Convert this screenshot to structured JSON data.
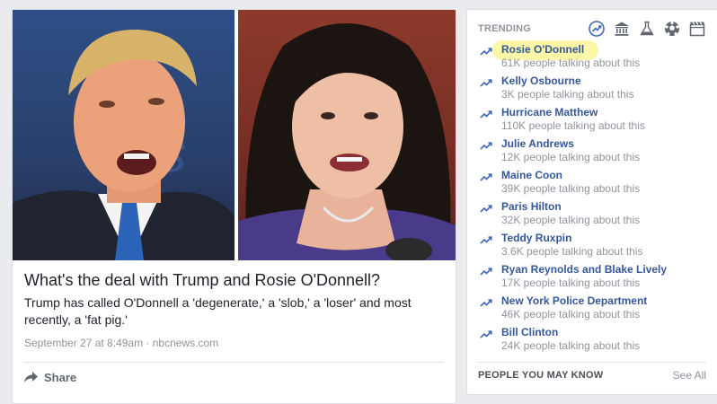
{
  "story": {
    "title": "What's the deal with Trump and Rosie O'Donnell?",
    "description": "Trump has called O'Donnell a 'degenerate,' a 'slob,' a 'loser' and most recently, a 'fat pig.'",
    "meta": "September 27 at 8:49am · nbcnews.com",
    "share_label": "Share"
  },
  "trending": {
    "header": "TRENDING",
    "categories": [
      "trending-icon",
      "politics-icon",
      "science-icon",
      "sports-icon",
      "entertainment-icon"
    ],
    "accent": "#4267b2",
    "highlight_color": "#fbf7a6",
    "items": [
      {
        "name": "Rosie O'Donnell",
        "count": "61K people talking about this",
        "highlighted": true
      },
      {
        "name": "Kelly Osbourne",
        "count": "3K people talking about this"
      },
      {
        "name": "Hurricane Matthew",
        "count": "110K people talking about this"
      },
      {
        "name": "Julie Andrews",
        "count": "12K people talking about this"
      },
      {
        "name": "Maine Coon",
        "count": "39K people talking about this"
      },
      {
        "name": "Paris Hilton",
        "count": "32K people talking about this"
      },
      {
        "name": "Teddy Ruxpin",
        "count": "3.6K people talking about this"
      },
      {
        "name": "Ryan Reynolds and Blake Lively",
        "count": "17K people talking about this"
      },
      {
        "name": "New York Police Department",
        "count": "46K people talking about this"
      },
      {
        "name": "Bill Clinton",
        "count": "24K people talking about this"
      }
    ]
  },
  "pymk": {
    "title": "PEOPLE YOU MAY KNOW",
    "see_all": "See All"
  }
}
